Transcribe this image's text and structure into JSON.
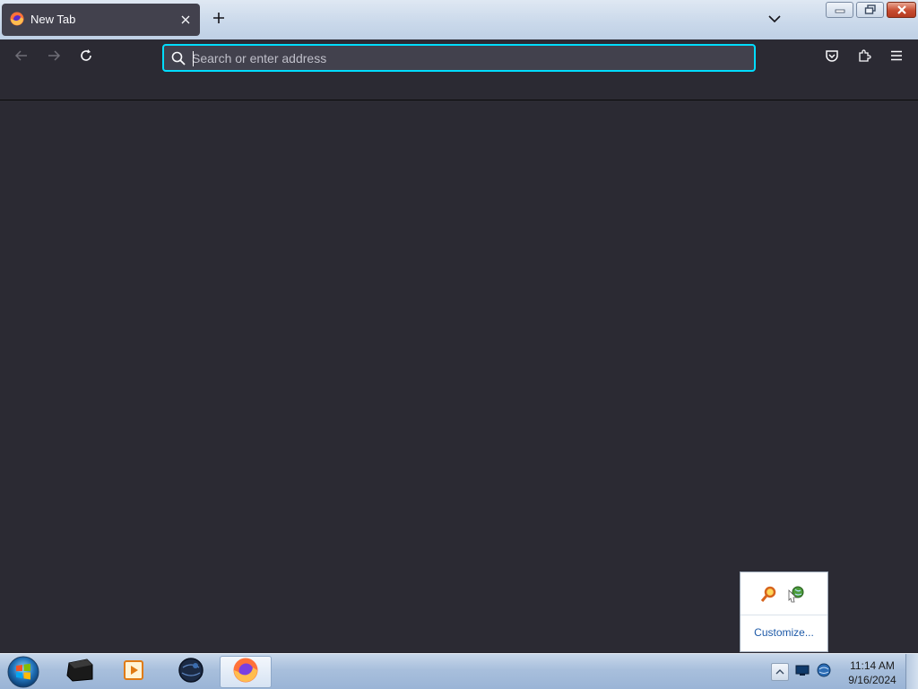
{
  "tab": {
    "title": "New Tab",
    "close_icon": "close-icon",
    "favicon": "firefox-icon"
  },
  "toolbar": {
    "new_tab_icon": "plus-icon",
    "list_all_tabs_icon": "chevron-down-icon",
    "back_icon": "arrow-left-icon",
    "forward_icon": "arrow-right-icon",
    "reload_icon": "reload-icon",
    "pocket_icon": "pocket-icon",
    "extensions_icon": "puzzle-icon",
    "menu_icon": "hamburger-icon"
  },
  "urlbar": {
    "value": "",
    "placeholder": "Search or enter address"
  },
  "window_controls": [
    "minimize",
    "restore",
    "close"
  ],
  "tray_popup": {
    "customize_label": "Customize..."
  },
  "taskbar": {
    "apps": [
      "start-orb",
      "terminal",
      "media-player",
      "network-globe",
      "firefox"
    ],
    "clock_time": "11:14 AM",
    "clock_date": "9/16/2024"
  },
  "colors": {
    "accent": "#00ddff",
    "chrome_bg": "#2b2a33",
    "field_bg": "#42414d"
  }
}
